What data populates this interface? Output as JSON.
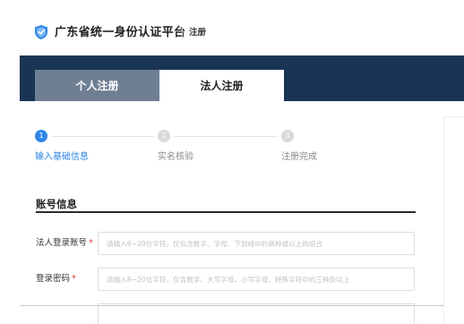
{
  "header": {
    "title": "广东省统一身份认证平台",
    "subtitle": "注册"
  },
  "tabs": [
    {
      "label": "个人注册",
      "active": false
    },
    {
      "label": "法人注册",
      "active": true
    }
  ],
  "steps": [
    {
      "number": "1",
      "label": "输入基础信息",
      "active": true
    },
    {
      "number": "2",
      "label": "实名核验",
      "active": false
    },
    {
      "number": "3",
      "label": "注册完成",
      "active": false
    }
  ],
  "section": {
    "title": "账号信息"
  },
  "fields": [
    {
      "label": "法人登录账号",
      "required_mark": "*",
      "placeholder": "请输入6~20位字符，仅包含数字、字母、下划线中的两种或以上的组合",
      "value": ""
    },
    {
      "label": "登录密码",
      "required_mark": "*",
      "placeholder": "请输入8~20位字符，仅含数字、大写字母、小写字母、特殊字符中的三种及以上",
      "value": ""
    }
  ],
  "colors": {
    "banner": "#1a3554",
    "accent": "#2d86e8",
    "required": "#e0322f"
  },
  "icons": {
    "logo": "shield-check-icon"
  }
}
